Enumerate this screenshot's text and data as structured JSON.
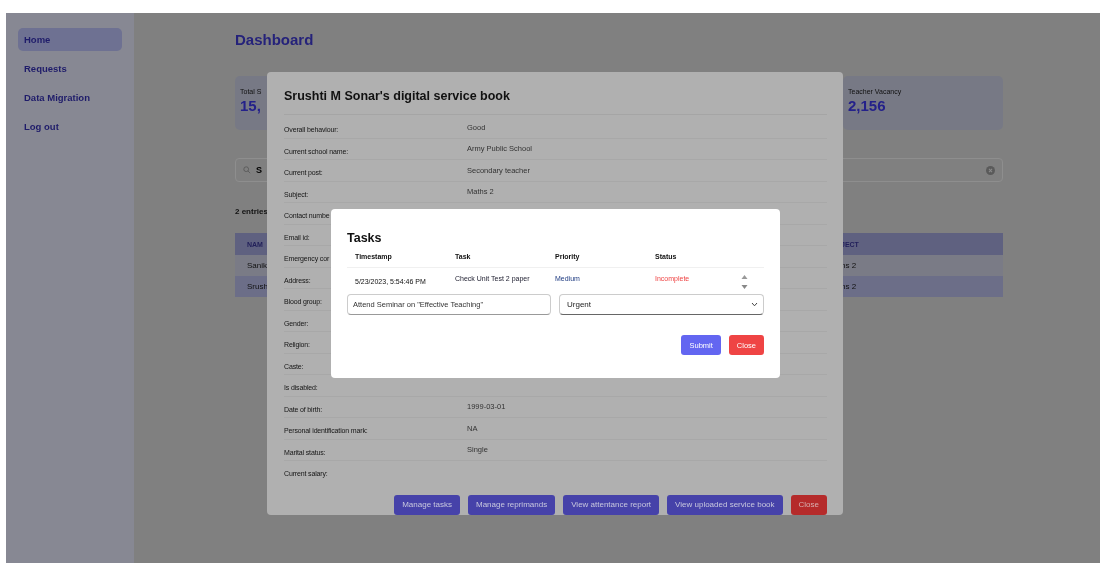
{
  "sidebar": {
    "items": [
      {
        "label": "Home",
        "selected": true
      },
      {
        "label": "Requests",
        "selected": false
      },
      {
        "label": "Data Migration",
        "selected": false
      },
      {
        "label": "Log out",
        "selected": false
      }
    ]
  },
  "page": {
    "title": "Dashboard",
    "cards": [
      {
        "label": "Total S",
        "value": "15,"
      },
      {
        "label": "Teacher Vacancy",
        "value": "2,156"
      }
    ],
    "search": {
      "value": "S"
    },
    "entries": "2 entries",
    "table": {
      "columns": [
        "NAM",
        "JECT"
      ],
      "rows": [
        {
          "cells": [
            "Sanik",
            "hs 2"
          ],
          "selected": false
        },
        {
          "cells": [
            "Srush",
            "hs 2"
          ],
          "selected": true
        }
      ]
    }
  },
  "service_book": {
    "title": "Srushti M Sonar's digital service book",
    "fields": [
      {
        "label": "Overall behaviour:",
        "value": "Good"
      },
      {
        "label": "Current school name:",
        "value": "Army Public School"
      },
      {
        "label": "Current post:",
        "value": "Secondary teacher"
      },
      {
        "label": "Subject:",
        "value": "Maths 2"
      },
      {
        "label": "Contact numbe"
      },
      {
        "label": "Email id:"
      },
      {
        "label": "Emergency cor"
      },
      {
        "label": "Address:"
      },
      {
        "label": "Blood group:"
      },
      {
        "label": "Gender:"
      },
      {
        "label": "Religion:"
      },
      {
        "label": "Caste:"
      },
      {
        "label": "Is disabled:"
      },
      {
        "label": "Date of birth:",
        "value": "1999-03-01"
      },
      {
        "label": "Personal identification mark:",
        "value": "NA"
      },
      {
        "label": "Marital status:",
        "value": "Single"
      },
      {
        "label": "Current salary:"
      }
    ],
    "buttons": [
      {
        "label": "Manage tasks",
        "kind": "primary"
      },
      {
        "label": "Manage reprimands",
        "kind": "primary"
      },
      {
        "label": "View attentance report",
        "kind": "primary"
      },
      {
        "label": "View uploaded service book",
        "kind": "primary"
      },
      {
        "label": "Close",
        "kind": "danger"
      }
    ]
  },
  "tasks_dialog": {
    "title": "Tasks",
    "columns": [
      "Timestamp",
      "Task",
      "Priority",
      "Status"
    ],
    "rows": [
      {
        "timestamp": "5/23/2023, 5:54:46 PM",
        "task": "Check Unit Test 2 paper",
        "priority": "Medium",
        "status": "Incomplete",
        "complete": false
      }
    ],
    "task_input": {
      "value": "Attend Seminar on \"Effective Teaching\""
    },
    "priority_select": {
      "value": "Urgent"
    },
    "buttons": [
      {
        "label": "Submit",
        "kind": "primary"
      },
      {
        "label": "Close",
        "kind": "danger"
      }
    ]
  }
}
